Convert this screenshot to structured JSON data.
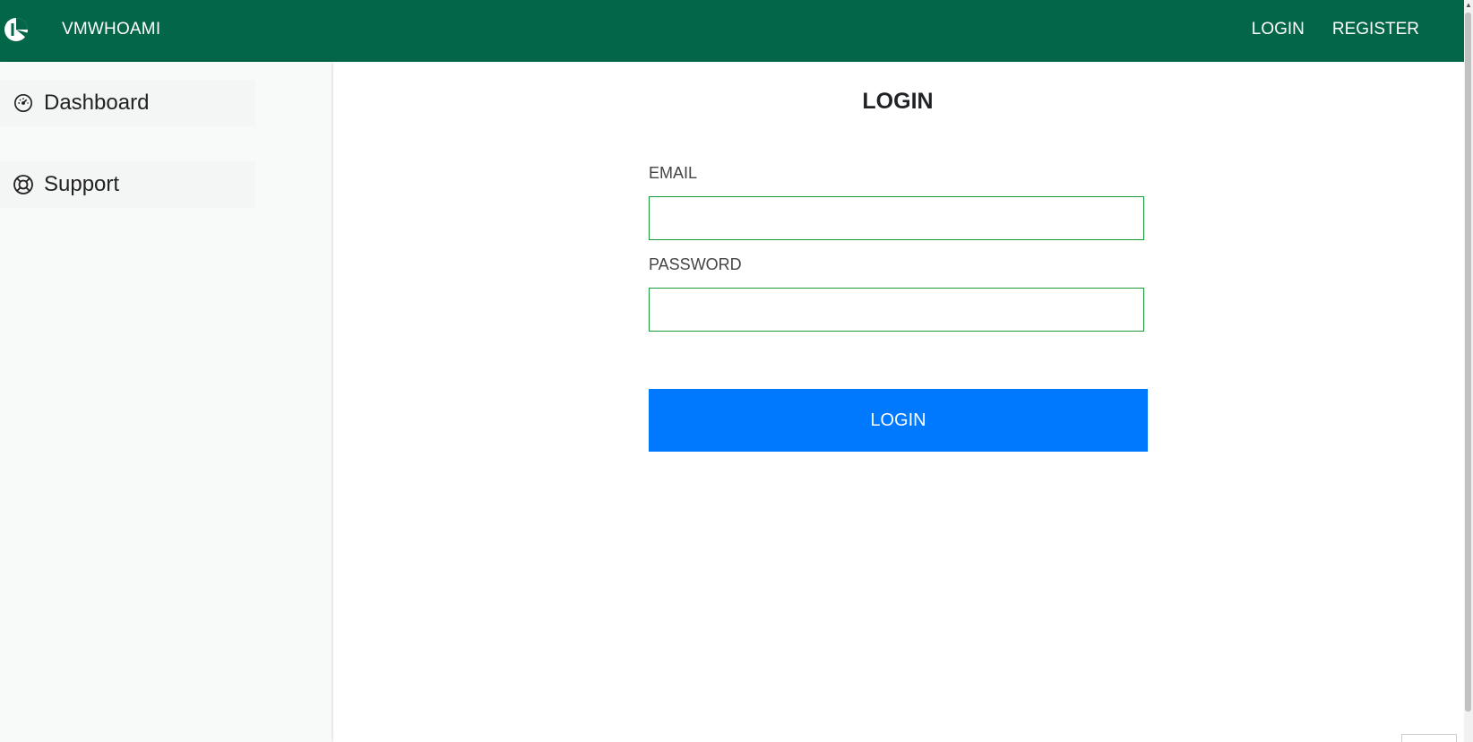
{
  "navbar": {
    "brand": "VMWHOAMI",
    "links": [
      {
        "label": "LOGIN"
      },
      {
        "label": "REGISTER"
      }
    ],
    "bg_color": "#036649"
  },
  "sidebar": {
    "items": [
      {
        "label": "Dashboard",
        "icon": "dashboard-gauge-icon"
      },
      {
        "label": "Support",
        "icon": "lifebuoy-icon"
      }
    ]
  },
  "form": {
    "title": "LOGIN",
    "email_label": "EMAIL",
    "email_value": "",
    "password_label": "PASSWORD",
    "password_value": "",
    "submit_label": "LOGIN",
    "submit_color": "#0179fe",
    "input_border_color": "#1c9b3c"
  }
}
